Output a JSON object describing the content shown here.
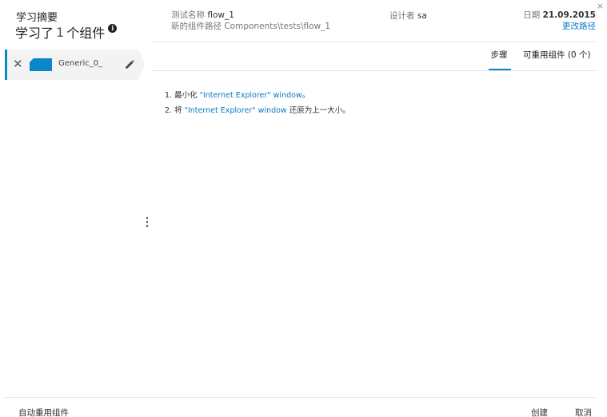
{
  "header": {
    "title": "学习摘要",
    "count_prefix": "学习了",
    "count_value": "1",
    "count_suffix": "个组件",
    "info_icon_glyph": "i",
    "test_name_label": "测试名称",
    "test_name_value": "flow_1",
    "new_path_label": "新的组件路径",
    "new_path_value": "Components\\tests\\flow_1",
    "designer_label": "设计者",
    "designer_value": "sa",
    "date_label": "日期",
    "date_value": "21.09.2015",
    "change_path_link": "更改路径",
    "close_glyph": "×"
  },
  "components": [
    {
      "name": "Generic_0_",
      "remove_glyph": "✕"
    }
  ],
  "tabs": {
    "steps": "步骤",
    "reusable": "可重用组件 (0 个)"
  },
  "steps": [
    {
      "prefix": "1. 最小化 ",
      "highlight": "\"Internet Explorer\" window",
      "suffix": "。"
    },
    {
      "prefix": "2. 将 ",
      "highlight": "\"Internet Explorer\" window",
      "suffix": " 还原为上一大小。"
    }
  ],
  "footer": {
    "auto_reuse": "自动重用组件",
    "create": "创建",
    "cancel": "取消"
  },
  "colors": {
    "accent": "#0a86c9",
    "link": "#0a7bc4"
  }
}
